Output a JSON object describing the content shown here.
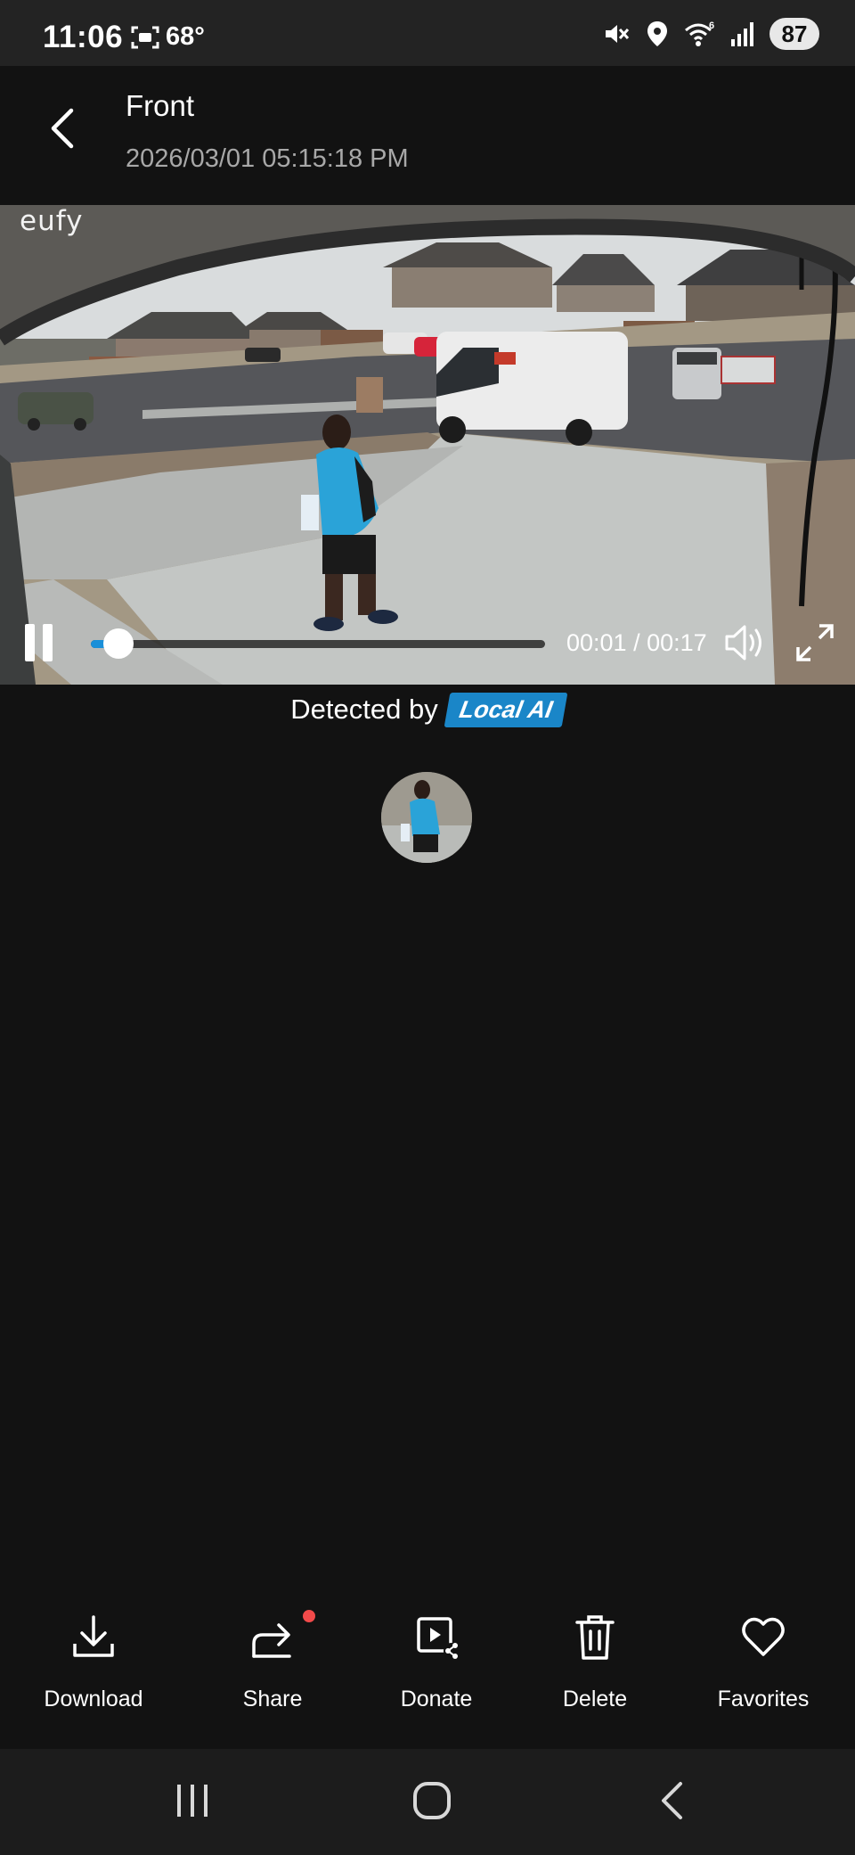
{
  "status_bar": {
    "time": "11:06",
    "temperature": "68°",
    "battery": "87",
    "icons": [
      "screen-record-icon",
      "mute-icon",
      "location-icon",
      "wifi-6-icon",
      "signal-icon"
    ]
  },
  "header": {
    "title": "Front",
    "timestamp": "2026/03/01 05:15:18 PM",
    "back_icon": "chevron-left-icon"
  },
  "video": {
    "watermark": "eufy",
    "time_readout": "00:01 / 00:17",
    "progress_fraction": 0.06,
    "state": "playing",
    "controls": [
      "pause-icon",
      "volume-icon",
      "fullscreen-icon"
    ]
  },
  "detection": {
    "label": "Detected by",
    "badge": "Local AI",
    "badge_color": "#1a86c8"
  },
  "actions": [
    {
      "label": "Download",
      "icon": "download-icon"
    },
    {
      "label": "Share",
      "icon": "share-icon",
      "badge": true
    },
    {
      "label": "Donate",
      "icon": "donate-video-icon"
    },
    {
      "label": "Delete",
      "icon": "trash-icon"
    },
    {
      "label": "Favorites",
      "icon": "heart-icon"
    }
  ],
  "colors": {
    "background": "#121212",
    "accent": "#1a8fd8",
    "notification_dot": "#f24a4a"
  }
}
